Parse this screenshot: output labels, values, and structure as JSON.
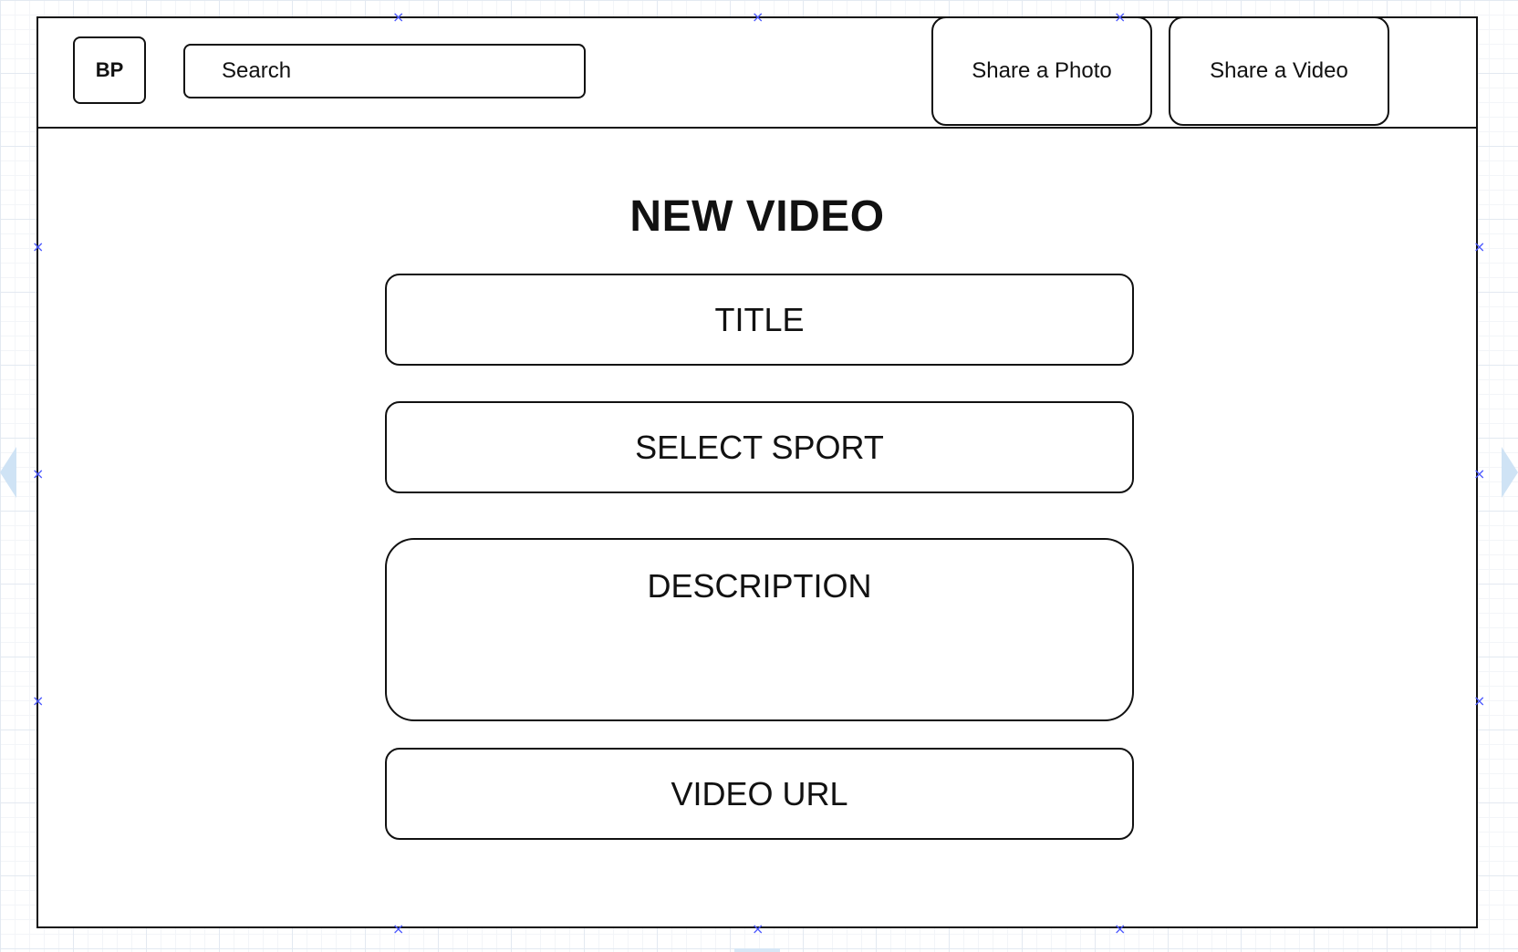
{
  "header": {
    "logo_text": "BP",
    "search_placeholder": "Search",
    "share_photo_label": "Share a Photo",
    "share_video_label": "Share a Video"
  },
  "page": {
    "title": "NEW VIDEO"
  },
  "form": {
    "title_label": "TITLE",
    "sport_label": "SELECT SPORT",
    "description_label": "DESCRIPTION",
    "video_url_label": "VIDEO URL"
  },
  "markers": {
    "symbol": "×",
    "color": "#4b58ff"
  },
  "colors": {
    "border": "#111111",
    "background": "#ffffff",
    "grid": "#e3e9f1"
  }
}
